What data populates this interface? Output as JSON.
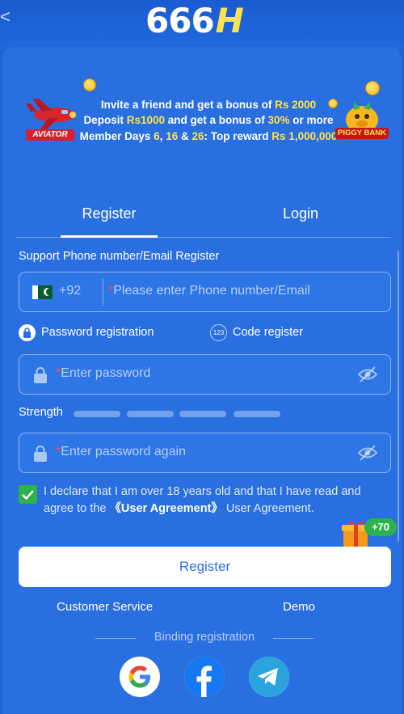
{
  "header": {
    "back_symbol": "<",
    "logo_text": "666",
    "logo_letter": "H"
  },
  "banner": {
    "line1_prefix": "Invite a friend and get a bonus of ",
    "line1_amount": "Rs 2000",
    "line2_prefix": "Deposit ",
    "line2_amount": "Rs1000",
    "line2_middle": " and get a bonus of ",
    "line2_percent": "30%",
    "line2_suffix": " or more",
    "line3_prefix": "Member Days ",
    "line3_day1": "6",
    "line3_sep1": ", ",
    "line3_day2": "16",
    "line3_sep2": " & ",
    "line3_day3": "26",
    "line3_middle": ": Top reward ",
    "line3_amount": "Rs 1,000,000",
    "aviator_label": "AVIATOR",
    "piggy_label": "PIGGY BANK"
  },
  "tabs": [
    {
      "label": "Register",
      "active": true
    },
    {
      "label": "Login",
      "active": false
    }
  ],
  "form": {
    "section_label": "Support Phone number/Email Register",
    "country_code": "+92",
    "required_mark": "*",
    "phone_placeholder": "Please enter Phone number/Email",
    "mode_password_label": "Password registration",
    "mode_code_label": "Code register",
    "mode_code_icon_text": "123",
    "password_placeholder": "Enter password",
    "strength_label": "Strength",
    "strength_level": 0,
    "strength_segments": 4,
    "password_again_placeholder": "Enter password again",
    "agree_checked": true,
    "agree_text_prefix": "I declare that I am over 18 years old and that I have read and agree to the ",
    "agree_link": "《User Agreement》",
    "agree_text_suffix": " User Agreement.",
    "bonus_badge": "+70",
    "register_button": "Register"
  },
  "footer": {
    "customer_service": "Customer Service",
    "demo": "Demo",
    "binding_label": "Binding registration",
    "social": [
      "google",
      "facebook",
      "telegram"
    ]
  },
  "colors": {
    "background": "#1f63d6",
    "panel": "#2a6fe0",
    "highlight": "#ffe34a",
    "check_green": "#2eb34a",
    "required_red": "#ff4a4a"
  }
}
